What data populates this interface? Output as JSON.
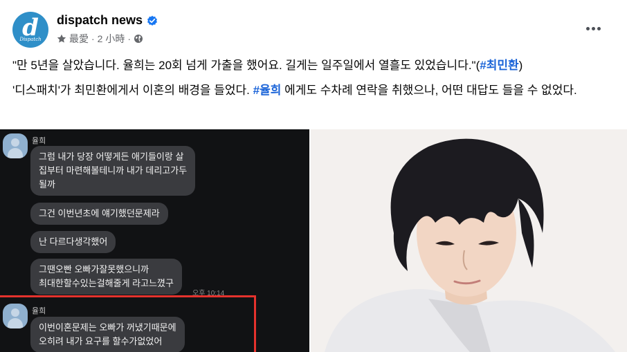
{
  "post": {
    "page_name": "dispatch news",
    "logo_letter": "d",
    "logo_word": "Dispatch",
    "meta_label": "最愛",
    "meta_time": "2 小時",
    "sep": "·",
    "paragraph1_text": "\"만 5년을 살았습니다. 율희는 20회 넘게 가출을 했어요. 길게는 일주일에서 열흘도 있었습니다.\"(",
    "paragraph1_hashtag": "#최민환",
    "paragraph1_end": ")",
    "paragraph2_text": "'디스패치'가 최민환에게서 이혼의 배경을 들었다. ",
    "paragraph2_hashtag": "#율희",
    "paragraph2_end": " 에게도 수차례 연락을 취했으나, 어떤 대답도 들을 수 없었다."
  },
  "chat": {
    "sender_name": "율희",
    "messages": [
      [
        "그럼 내가 당장 어떻게든 애기들이랑 살",
        "집부터 마련해볼테니까 내가 데리고가두",
        "될까"
      ],
      [
        "그건 이번년초에 얘기했던문제라"
      ],
      [
        "난 다르다생각했어"
      ],
      [
        "그땐오빤 오빠가잘못했으니까",
        "최대한할수있는걸해줄게 라고느꼈구"
      ],
      [
        "이번이혼문제는 오빠가 꺼냈기때문에",
        "오히려 내가 요구를 할수가없었어"
      ]
    ],
    "time": "오후 10:14"
  },
  "icons": {
    "verified": "verified-badge-icon",
    "star": "star-icon",
    "globe": "globe-icon",
    "more": "more-options-icon"
  },
  "colors": {
    "hashtag": "#1b64d8",
    "verified": "#1877f2",
    "highlight": "#e5322d",
    "logo_bg": "#2f8fc8"
  }
}
